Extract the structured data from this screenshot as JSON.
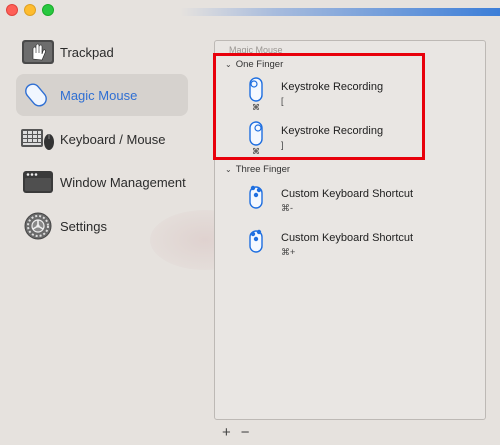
{
  "window": {
    "controls": [
      "close",
      "minimize",
      "zoom"
    ]
  },
  "sidebar": {
    "items": [
      {
        "label": "Trackpad",
        "icon": "trackpad-hand-icon"
      },
      {
        "label": "Magic Mouse",
        "icon": "magic-mouse-icon",
        "selected": true
      },
      {
        "label": "Keyboard / Mouse",
        "icon": "keyboard-mouse-icon"
      },
      {
        "label": "Window Management",
        "icon": "window-management-icon"
      },
      {
        "label": "Settings",
        "icon": "settings-gear-icon"
      }
    ]
  },
  "panel": {
    "title": "Magic Mouse",
    "groups": [
      {
        "header": "One Finger",
        "rows": [
          {
            "modifier": "⌘",
            "title": "Keystroke Recording",
            "subtitle": "[",
            "icon": "one-finger-left-tap-icon"
          },
          {
            "modifier": "⌘",
            "title": "Keystroke Recording",
            "subtitle": "]",
            "icon": "one-finger-right-tap-icon"
          }
        ]
      },
      {
        "header": "Three Finger",
        "rows": [
          {
            "modifier": "",
            "title": "Custom Keyboard Shortcut",
            "subtitle": "⌘-",
            "icon": "three-finger-left-icon"
          },
          {
            "modifier": "",
            "title": "Custom Keyboard Shortcut",
            "subtitle": "⌘+",
            "icon": "three-finger-right-icon"
          }
        ]
      }
    ]
  },
  "bottom_bar": {
    "add_label": "+",
    "remove_label": "−"
  },
  "colors": {
    "accent": "#2f6fd3",
    "highlight_box": "#e8000b",
    "icon_blue": "#1f6fe0"
  }
}
